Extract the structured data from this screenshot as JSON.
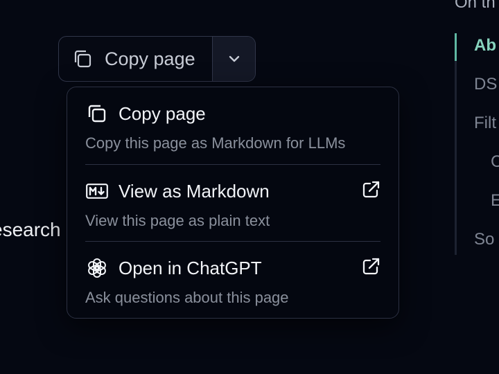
{
  "background": {
    "partial_text": "esearch"
  },
  "toc": {
    "heading": "On th",
    "items": [
      {
        "label": "Ab",
        "active": true
      },
      {
        "label": "DS",
        "active": false
      },
      {
        "label": "Filt",
        "active": false
      },
      {
        "label": "C",
        "active": false
      },
      {
        "label": "E",
        "active": false
      },
      {
        "label": "So",
        "active": false
      }
    ]
  },
  "copy_button": {
    "label": "Copy page",
    "icon": "copy-icon",
    "caret_icon": "chevron-down-icon"
  },
  "menu": {
    "items": [
      {
        "title": "Copy page",
        "description": "Copy this page as Markdown for LLMs",
        "icon": "copy-icon",
        "external": false
      },
      {
        "title": "View as Markdown",
        "description": "View this page as plain text",
        "icon": "markdown-icon",
        "external": true
      },
      {
        "title": "Open in ChatGPT",
        "description": "Ask questions about this page",
        "icon": "chatgpt-icon",
        "external": true
      }
    ]
  },
  "colors": {
    "background": "#050812",
    "accent": "#86d3bd",
    "border": "#2c3143"
  }
}
